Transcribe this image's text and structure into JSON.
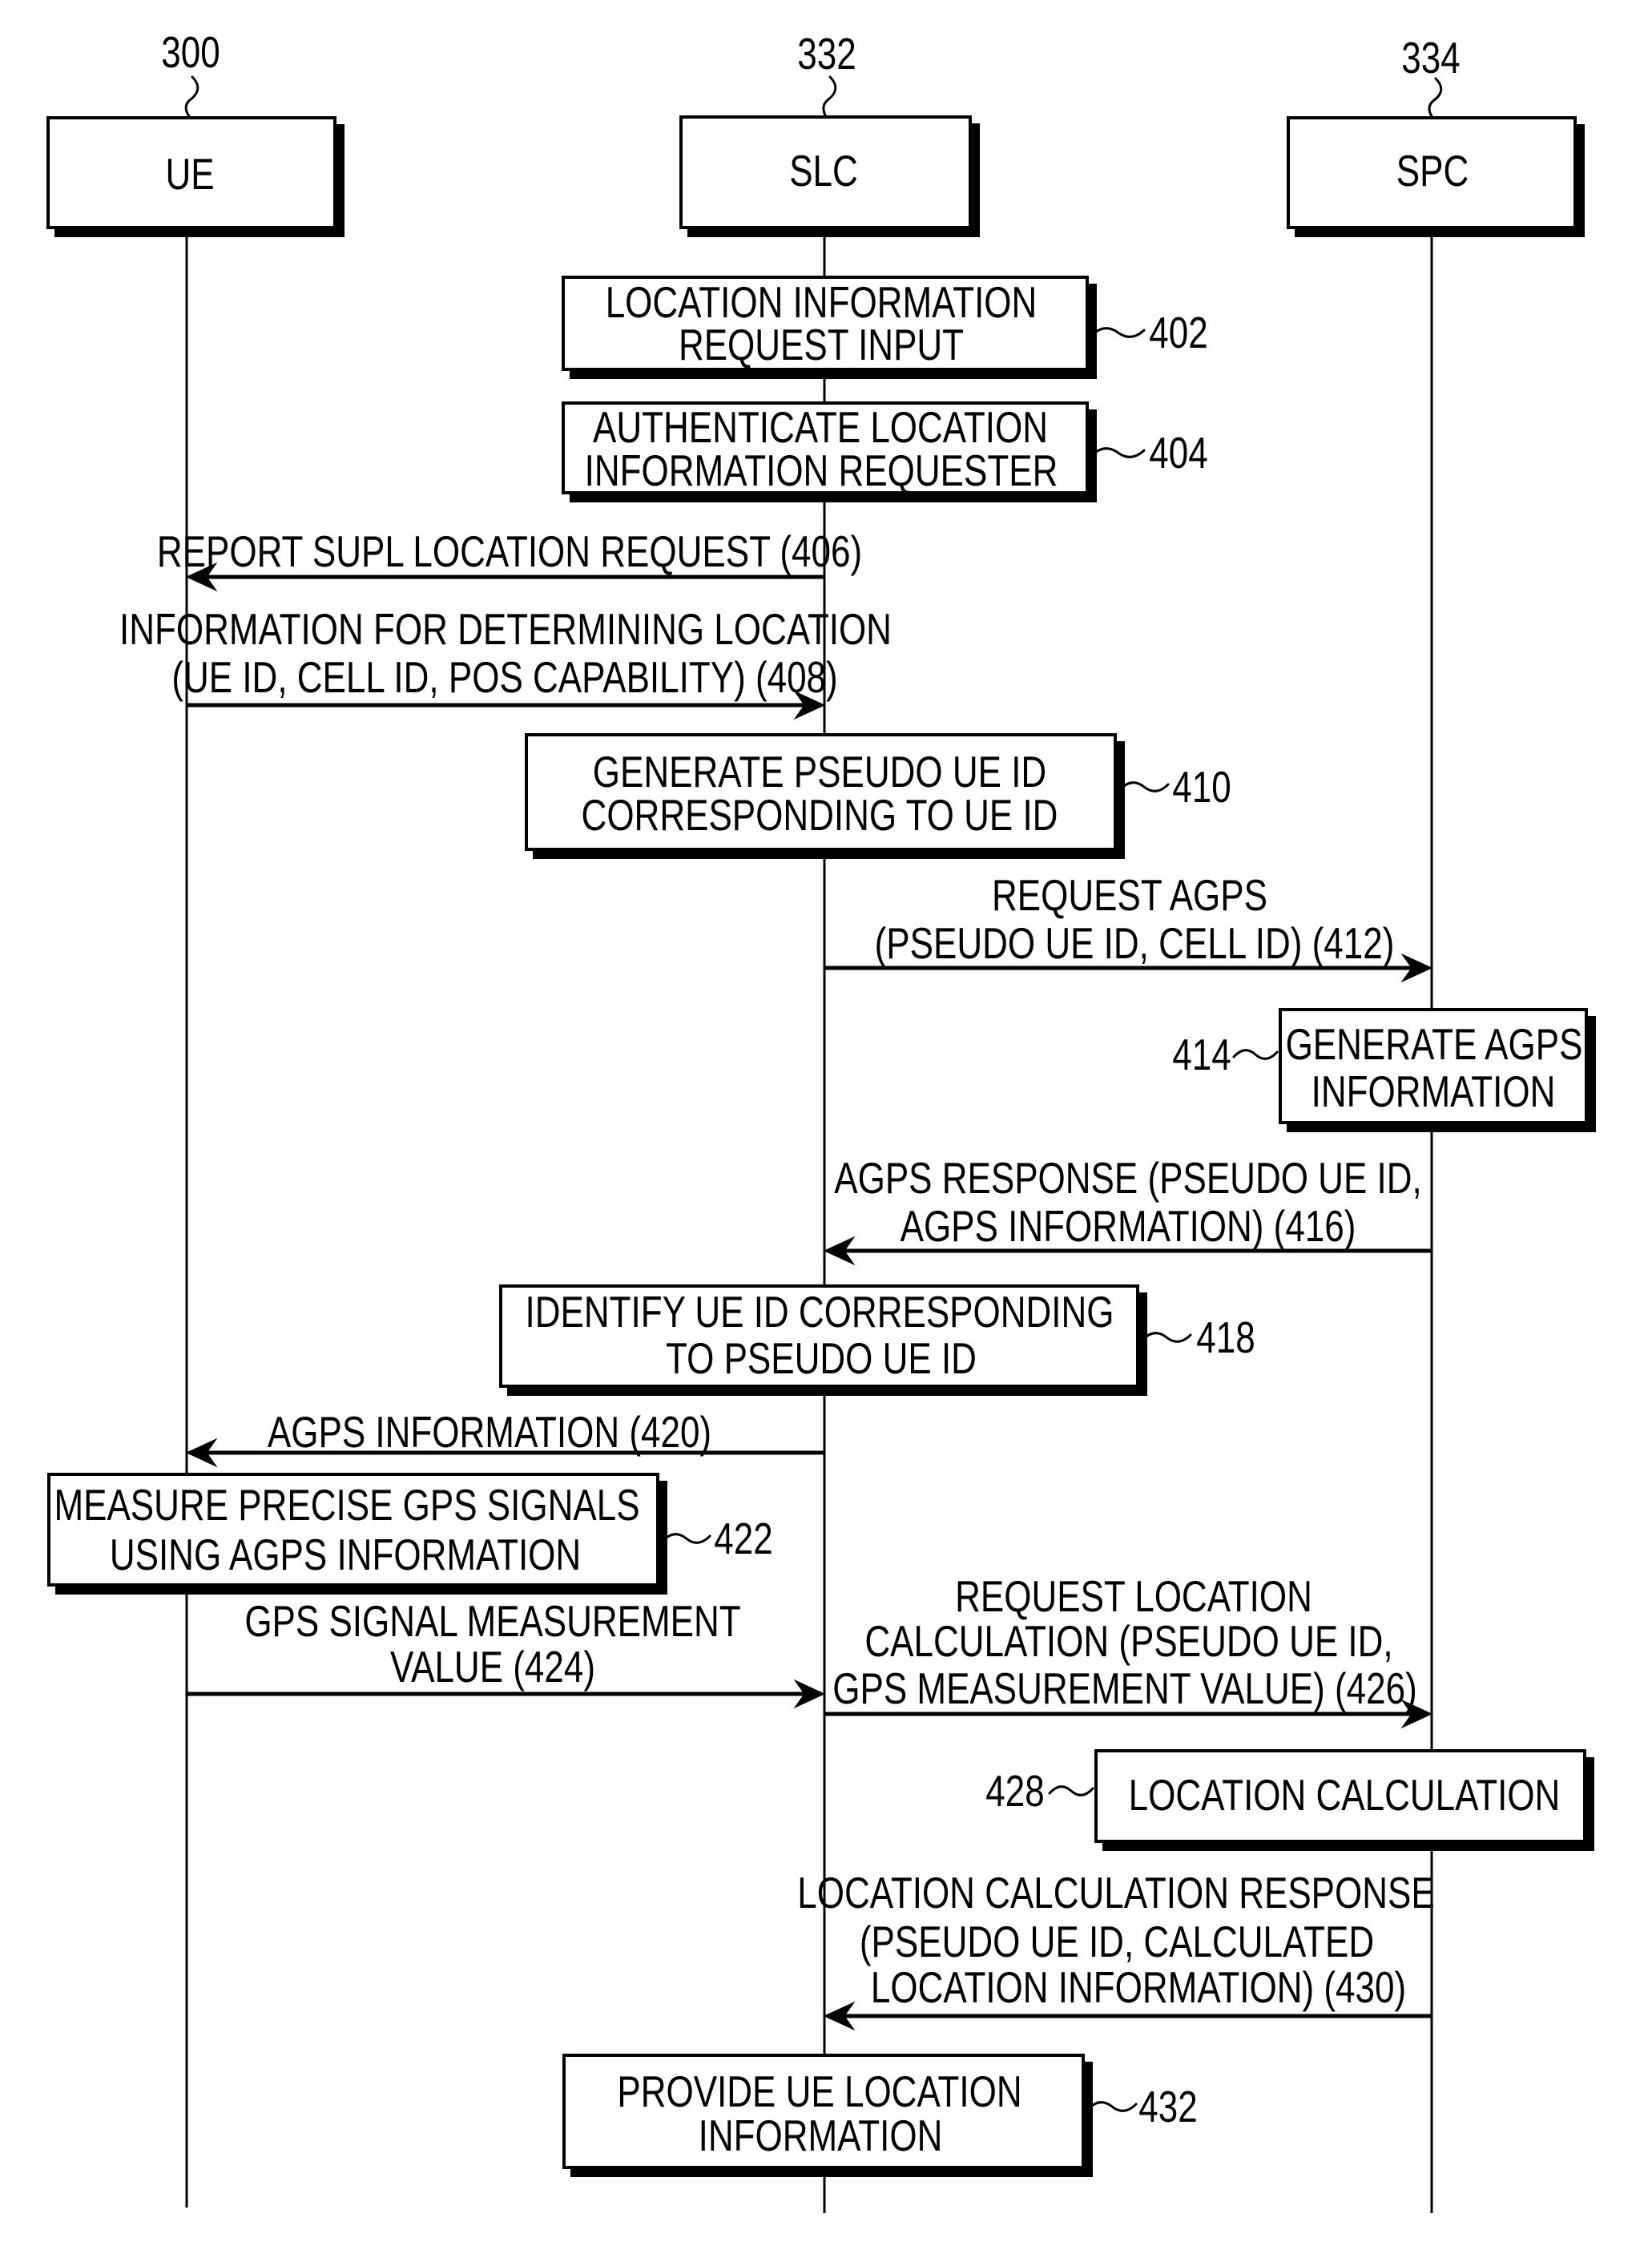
{
  "participants": [
    {
      "ref": "300",
      "name": "UE"
    },
    {
      "ref": "332",
      "name": "SLC"
    },
    {
      "ref": "334",
      "name": "SPC"
    }
  ],
  "steps": [
    {
      "ref": "402",
      "owner": "SLC",
      "lines": [
        "LOCATION INFORMATION",
        "REQUEST INPUT"
      ]
    },
    {
      "ref": "404",
      "owner": "SLC",
      "lines": [
        "AUTHENTICATE LOCATION",
        "INFORMATION REQUESTER"
      ]
    },
    {
      "ref": "410",
      "owner": "SLC",
      "lines": [
        "GENERATE PSEUDO UE ID",
        "CORRESPONDING TO UE ID"
      ]
    },
    {
      "ref": "414",
      "owner": "SPC",
      "lines": [
        "GENERATE AGPS",
        "INFORMATION"
      ]
    },
    {
      "ref": "418",
      "owner": "SLC",
      "lines": [
        "IDENTIFY UE ID CORRESPONDING",
        "TO PSEUDO UE ID"
      ]
    },
    {
      "ref": "422",
      "owner": "UE",
      "lines": [
        "MEASURE PRECISE GPS SIGNALS",
        "USING AGPS INFORMATION"
      ]
    },
    {
      "ref": "428",
      "owner": "SPC",
      "lines": [
        "LOCATION CALCULATION"
      ]
    },
    {
      "ref": "432",
      "owner": "SLC",
      "lines": [
        "PROVIDE UE LOCATION",
        "INFORMATION"
      ]
    }
  ],
  "messages": [
    {
      "from": "SLC",
      "to": "UE",
      "lines": [
        "REPORT SUPL LOCATION REQUEST (406)"
      ]
    },
    {
      "from": "UE",
      "to": "SLC",
      "lines": [
        "INFORMATION FOR DETERMINING LOCATION",
        "(UE ID, CELL ID, POS CAPABILITY) (408)"
      ]
    },
    {
      "from": "SLC",
      "to": "SPC",
      "lines": [
        "REQUEST AGPS",
        "(PSEUDO UE ID, CELL ID) (412)"
      ]
    },
    {
      "from": "SPC",
      "to": "SLC",
      "lines": [
        "AGPS RESPONSE (PSEUDO UE ID,",
        "AGPS INFORMATION) (416)"
      ]
    },
    {
      "from": "SLC",
      "to": "UE",
      "lines": [
        "AGPS INFORMATION (420)"
      ]
    },
    {
      "from": "UE",
      "to": "SLC",
      "lines": [
        "GPS SIGNAL MEASUREMENT",
        "VALUE (424)"
      ]
    },
    {
      "from": "SLC",
      "to": "SPC",
      "lines": [
        "REQUEST LOCATION",
        "CALCULATION (PSEUDO UE ID,",
        "GPS MEASUREMENT VALUE) (426)"
      ]
    },
    {
      "from": "SPC",
      "to": "SLC",
      "lines": [
        "LOCATION CALCULATION RESPONSE",
        "(PSEUDO UE ID, CALCULATED",
        "LOCATION INFORMATION) (430)"
      ]
    }
  ]
}
